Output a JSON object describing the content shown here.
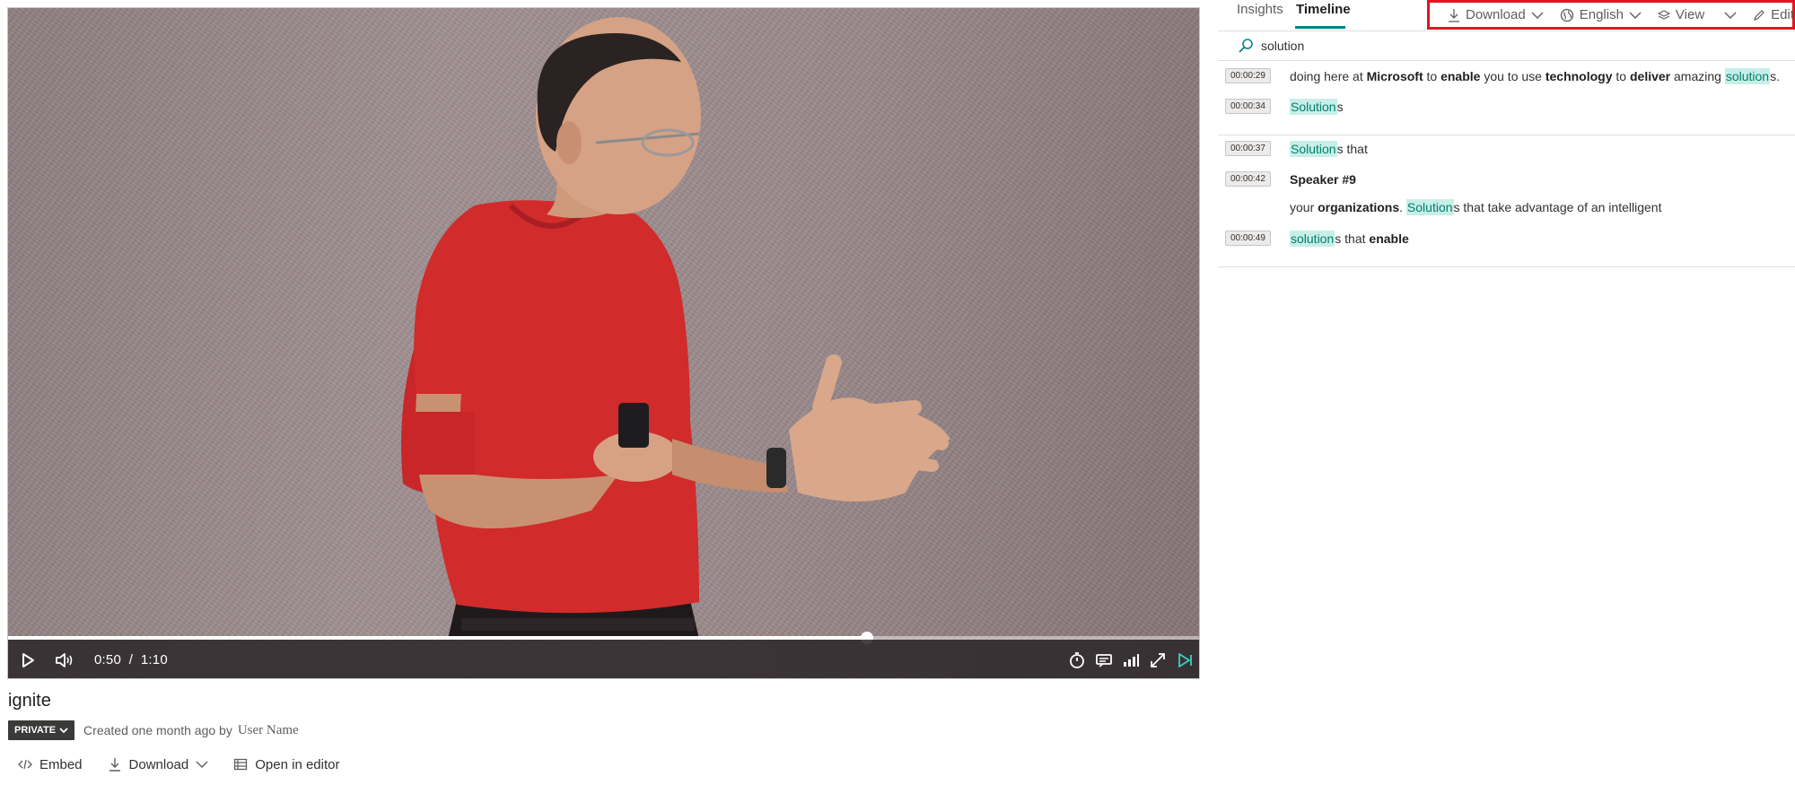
{
  "player": {
    "current_time": "0:50",
    "separator": "/",
    "duration": "1:10",
    "progress_fraction": 0.72
  },
  "video": {
    "title": "ignite",
    "privacy_label": "PRIVATE",
    "created_text": "Created one month ago by",
    "owner": "User Name",
    "actions": {
      "embed": "Embed",
      "download": "Download",
      "open_in_editor": "Open in editor"
    }
  },
  "panel": {
    "tabs": {
      "insights": "Insights",
      "timeline": "Timeline"
    },
    "toolbar": {
      "download": "Download",
      "language": "English",
      "view": "View",
      "edit": "Edit"
    },
    "search_value": "solution",
    "timeline": [
      {
        "time": "00:00:29"
      },
      {
        "time": "00:00:34"
      },
      {
        "time": "00:00:37"
      },
      {
        "time": "00:00:42"
      },
      {
        "time": "00:00:49"
      }
    ],
    "lines": {
      "l1": [
        "doing here at ",
        "Microsoft",
        " to ",
        "enable",
        " you to use ",
        "technology",
        " to ",
        "deliver",
        " amazing ",
        "solution",
        "s."
      ],
      "l2": [
        "Solution",
        "s"
      ],
      "l3": [
        "Solution",
        "s that"
      ],
      "l4": [
        "Speaker #9"
      ],
      "l5": [
        "your ",
        "organizations",
        ". ",
        "Solution",
        "s that take advantage of an intelligent"
      ],
      "l6": [
        "solution",
        "s that ",
        "enable"
      ]
    }
  },
  "colors": {
    "accent": "#00828a",
    "highlight_bg": "#c8eee8",
    "highlight_text": "#00806c",
    "toolbar_outline": "#e81123",
    "private_badge": "#3b3a39"
  }
}
